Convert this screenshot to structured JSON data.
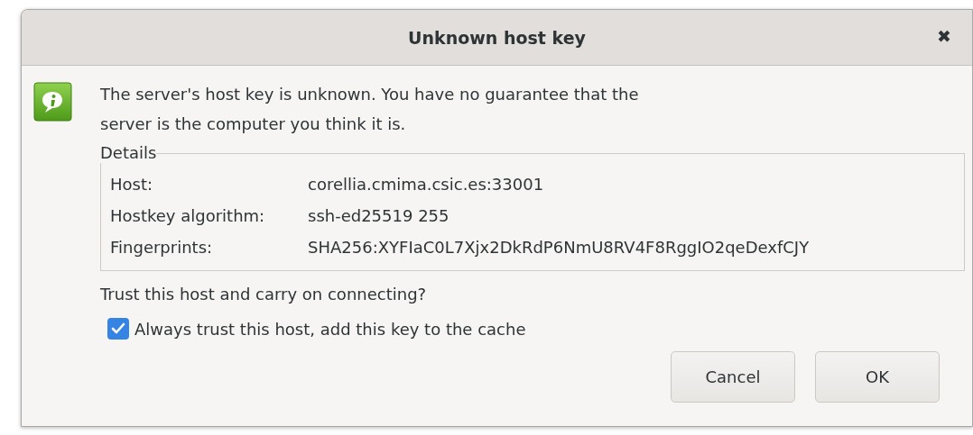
{
  "window": {
    "title": "Unknown host key",
    "close": "✖"
  },
  "message": "The server's host key is unknown. You have no guarantee that the server is the computer you think it is.",
  "details": {
    "legend": "Details",
    "rows": [
      {
        "label": "Host:",
        "value": "corellia.cmima.csic.es:33001"
      },
      {
        "label": "Hostkey algorithm:",
        "value": "ssh-ed25519 255"
      },
      {
        "label": "Fingerprints:",
        "value": "SHA256:XYFIaC0L7Xjx2DkRdP6NmU8RV4F8RggIO2qeDexfCJY"
      }
    ]
  },
  "question": "Trust this host and carry on connecting?",
  "always_trust": {
    "label": "Always trust this host, add this key to the cache",
    "checked": true
  },
  "buttons": [
    "Cancel",
    "OK"
  ]
}
